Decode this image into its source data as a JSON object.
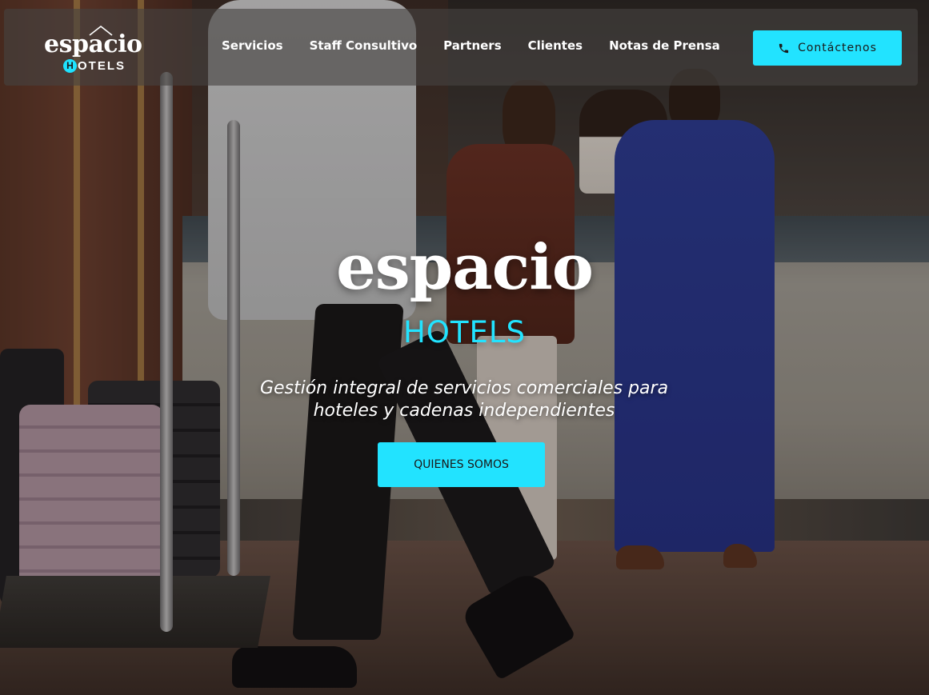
{
  "logo": {
    "word": "espacio",
    "h_letter": "H",
    "sub_rest": "OTELS"
  },
  "nav": {
    "items": [
      {
        "label": "Servicios"
      },
      {
        "label": "Staff Consultivo"
      },
      {
        "label": "Partners"
      },
      {
        "label": "Clientes"
      },
      {
        "label": "Notas de Prensa"
      }
    ]
  },
  "contact": {
    "label": "Contáctenos",
    "icon": "phone-icon"
  },
  "hero": {
    "title": "espacio",
    "subtitle": "HOTELS",
    "tagline_line1": "Gestión integral de servicios comerciales para",
    "tagline_line2": "hoteles y cadenas independientes",
    "cta_label": "QUIENES SOMOS",
    "background": "hotel-lobby-photo"
  },
  "colors": {
    "accent": "#22e3ff",
    "header_bg": "#464240",
    "text_light": "#ffffff",
    "text_dark": "#1a1a1a"
  }
}
